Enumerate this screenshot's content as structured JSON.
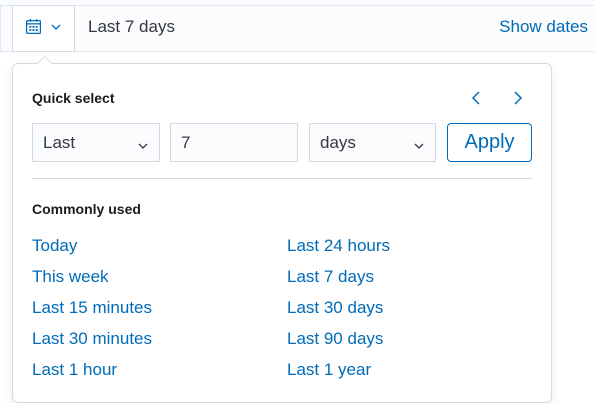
{
  "picker": {
    "value": "Last 7 days",
    "show_dates_label": "Show dates"
  },
  "quick_select": {
    "title": "Quick select",
    "unit_direction": "Last",
    "amount": "7",
    "unit": "days",
    "apply_label": "Apply"
  },
  "commonly_used": {
    "title": "Commonly used",
    "left_column": [
      "Today",
      "This week",
      "Last 15 minutes",
      "Last 30 minutes",
      "Last 1 hour"
    ],
    "right_column": [
      "Last 24 hours",
      "Last 7 days",
      "Last 30 days",
      "Last 90 days",
      "Last 1 year"
    ]
  },
  "icons": {
    "calendar": "calendar-icon",
    "chevron_down": "chevron-down-icon",
    "previous": "chevron-left-icon",
    "next": "chevron-right-icon"
  },
  "colors": {
    "link": "#006bb8",
    "border": "#d3dae6",
    "field_bg": "#fbfcfd"
  }
}
